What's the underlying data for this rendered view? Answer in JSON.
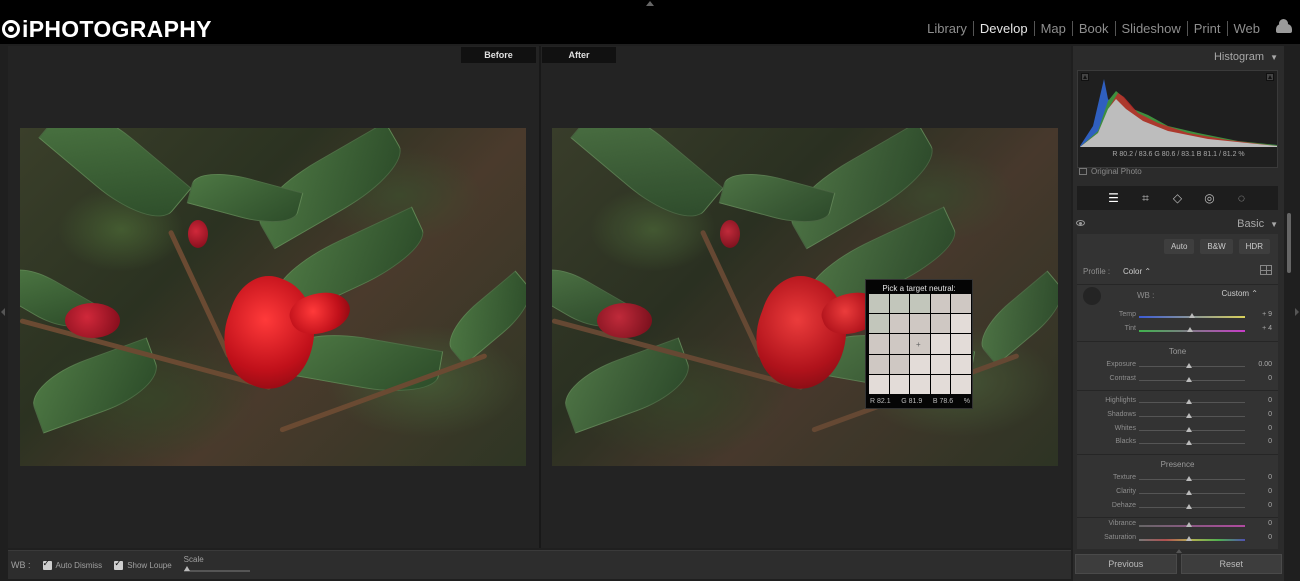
{
  "app": {
    "logo_text": "iPHOTOGRAPHY",
    "modules": [
      "Library",
      "Develop",
      "Map",
      "Book",
      "Slideshow",
      "Print",
      "Web"
    ],
    "active_module": "Develop"
  },
  "view": {
    "before_label": "Before",
    "after_label": "After"
  },
  "picker": {
    "title": "Pick a target neutral:",
    "r": "R  82.1",
    "g": "G  81.9",
    "b": "B  78.6",
    "unit": "%"
  },
  "toolbar": {
    "wb_label": "WB :",
    "auto_dismiss": "Auto Dismiss",
    "show_loupe": "Show Loupe",
    "scale": "Scale"
  },
  "histogram": {
    "title": "Histogram",
    "readout": "R  80.2 / 83.6   G  80.6 / 83.1   B  81.1 / 81.2  %",
    "original_photo": "Original Photo"
  },
  "basic": {
    "title": "Basic",
    "buttons": [
      "Auto",
      "B&W",
      "HDR"
    ],
    "profile_label": "Profile :",
    "profile_value": "Color ⌃",
    "wb_label": "WB :",
    "wb_value": "Custom ⌃",
    "tone_title": "Tone",
    "presence_title": "Presence",
    "sliders": {
      "temp": {
        "label": "Temp",
        "value": "+ 9"
      },
      "tint": {
        "label": "Tint",
        "value": "+ 4"
      },
      "exposure": {
        "label": "Exposure",
        "value": "0.00"
      },
      "contrast": {
        "label": "Contrast",
        "value": "0"
      },
      "highlights": {
        "label": "Highlights",
        "value": "0"
      },
      "shadows": {
        "label": "Shadows",
        "value": "0"
      },
      "whites": {
        "label": "Whites",
        "value": "0"
      },
      "blacks": {
        "label": "Blacks",
        "value": "0"
      },
      "texture": {
        "label": "Texture",
        "value": "0"
      },
      "clarity": {
        "label": "Clarity",
        "value": "0"
      },
      "dehaze": {
        "label": "Dehaze",
        "value": "0"
      },
      "vibrance": {
        "label": "Vibrance",
        "value": "0"
      },
      "saturation": {
        "label": "Saturation",
        "value": "0"
      }
    }
  },
  "footer": {
    "previous": "Previous",
    "reset": "Reset"
  }
}
